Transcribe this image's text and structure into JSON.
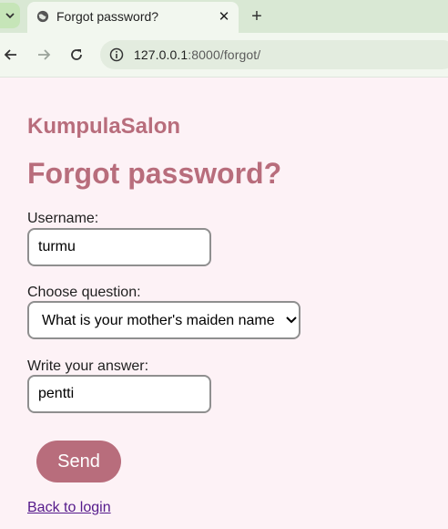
{
  "browser": {
    "tab_title": "Forgot password?",
    "tab_close": "✕",
    "new_tab": "+",
    "url_host": "127.0.0.1",
    "url_path": ":8000/forgot/"
  },
  "page": {
    "brand": "KumpulaSalon",
    "heading": "Forgot password?",
    "username_label": "Username:",
    "username_value": "turmu",
    "question_label": "Choose question:",
    "question_selected": "What is your mother's maiden name",
    "answer_label": "Write your answer:",
    "answer_value": "pentti",
    "send_label": "Send",
    "back_link": "Back to login"
  },
  "colors": {
    "accent": "#b86d7c",
    "page_background": "#fdf2f6",
    "link": "#551a8b"
  },
  "icons": [
    "tab-search-icon",
    "globe-icon",
    "close-icon",
    "plus-icon",
    "back-arrow-icon",
    "forward-arrow-icon",
    "reload-icon",
    "site-info-icon",
    "chevron-down-icon"
  ]
}
